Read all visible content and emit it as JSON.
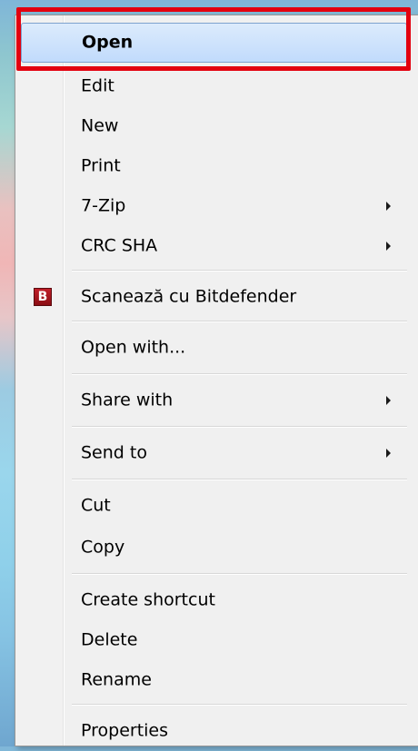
{
  "context_menu": {
    "items": [
      {
        "label": "Open",
        "bold": true,
        "submenu": false
      },
      {
        "label": "Edit",
        "submenu": false
      },
      {
        "label": "New",
        "submenu": false
      },
      {
        "label": "Print",
        "submenu": false
      },
      {
        "label": "7-Zip",
        "submenu": true
      },
      {
        "label": "CRC SHA",
        "submenu": true
      },
      {
        "label": "Scanează cu Bitdefender",
        "submenu": false,
        "icon": "bitdefender-icon"
      },
      {
        "label": "Open with...",
        "submenu": false
      },
      {
        "label": "Share with",
        "submenu": true
      },
      {
        "label": "Send to",
        "submenu": true
      },
      {
        "label": "Cut",
        "submenu": false
      },
      {
        "label": "Copy",
        "submenu": false
      },
      {
        "label": "Create shortcut",
        "submenu": false
      },
      {
        "label": "Delete",
        "submenu": false
      },
      {
        "label": "Rename",
        "submenu": false
      },
      {
        "label": "Properties",
        "submenu": false
      }
    ],
    "bitdefender_icon_glyph": "B",
    "highlight_color": "#e3000f"
  }
}
